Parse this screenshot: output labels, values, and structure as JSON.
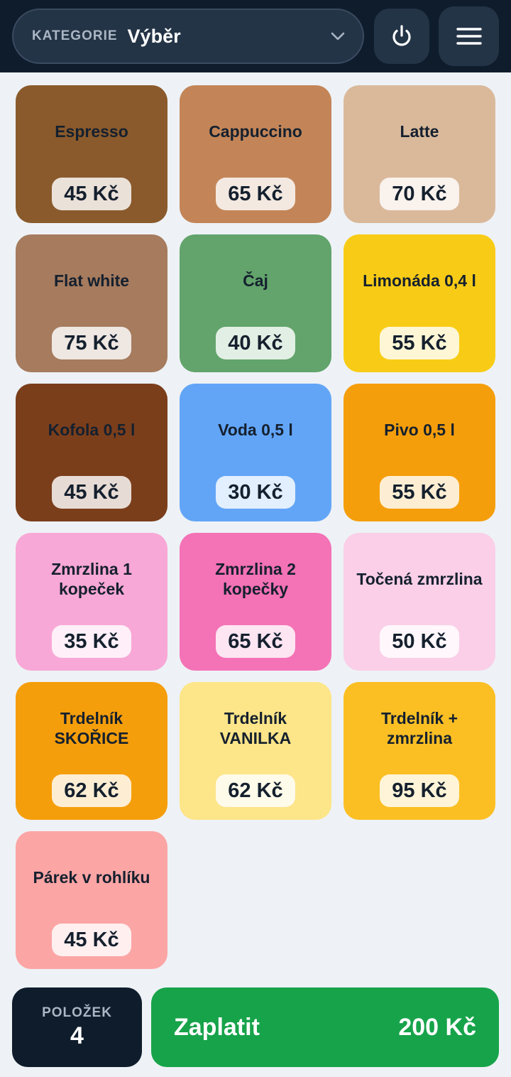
{
  "header": {
    "category_label": "KATEGORIE",
    "category_value": "Výběr",
    "power_icon": "power-icon",
    "menu_icon": "hamburger-menu-icon"
  },
  "products": [
    {
      "name": "Espresso",
      "price": "45 Kč",
      "color": "#8a5a2c"
    },
    {
      "name": "Cappuccino",
      "price": "65 Kč",
      "color": "#c38558"
    },
    {
      "name": "Latte",
      "price": "70 Kč",
      "color": "#dab99b"
    },
    {
      "name": "Flat white",
      "price": "75 Kč",
      "color": "#a67b5e"
    },
    {
      "name": "Čaj",
      "price": "40 Kč",
      "color": "#62a46b"
    },
    {
      "name": "Limonáda 0,4 l",
      "price": "55 Kč",
      "color": "#f8cc16"
    },
    {
      "name": "Kofola 0,5 l",
      "price": "45 Kč",
      "color": "#7b3e1b"
    },
    {
      "name": "Voda 0,5 l",
      "price": "30 Kč",
      "color": "#62a5f7"
    },
    {
      "name": "Pivo 0,5 l",
      "price": "55 Kč",
      "color": "#f59e0b"
    },
    {
      "name": "Zmrzlina 1 kopeček",
      "price": "35 Kč",
      "color": "#f8a8d6"
    },
    {
      "name": "Zmrzlina 2 kopečky",
      "price": "65 Kč",
      "color": "#f472b6"
    },
    {
      "name": "Točená zmrzlina",
      "price": "50 Kč",
      "color": "#fbcfe8"
    },
    {
      "name": "Trdelník SKOŘICE",
      "price": "62 Kč",
      "color": "#f59e0b"
    },
    {
      "name": "Trdelník VANILKA",
      "price": "62 Kč",
      "color": "#fde589"
    },
    {
      "name": "Trdelník + zmrzlina",
      "price": "95 Kč",
      "color": "#fbbf24"
    },
    {
      "name": "Párek v rohlíku",
      "price": "45 Kč",
      "color": "#fca5a5"
    }
  ],
  "footer": {
    "count_label": "POLOŽEK",
    "count_value": "4",
    "pay_label": "Zaplatit",
    "total": "200 Kč"
  }
}
